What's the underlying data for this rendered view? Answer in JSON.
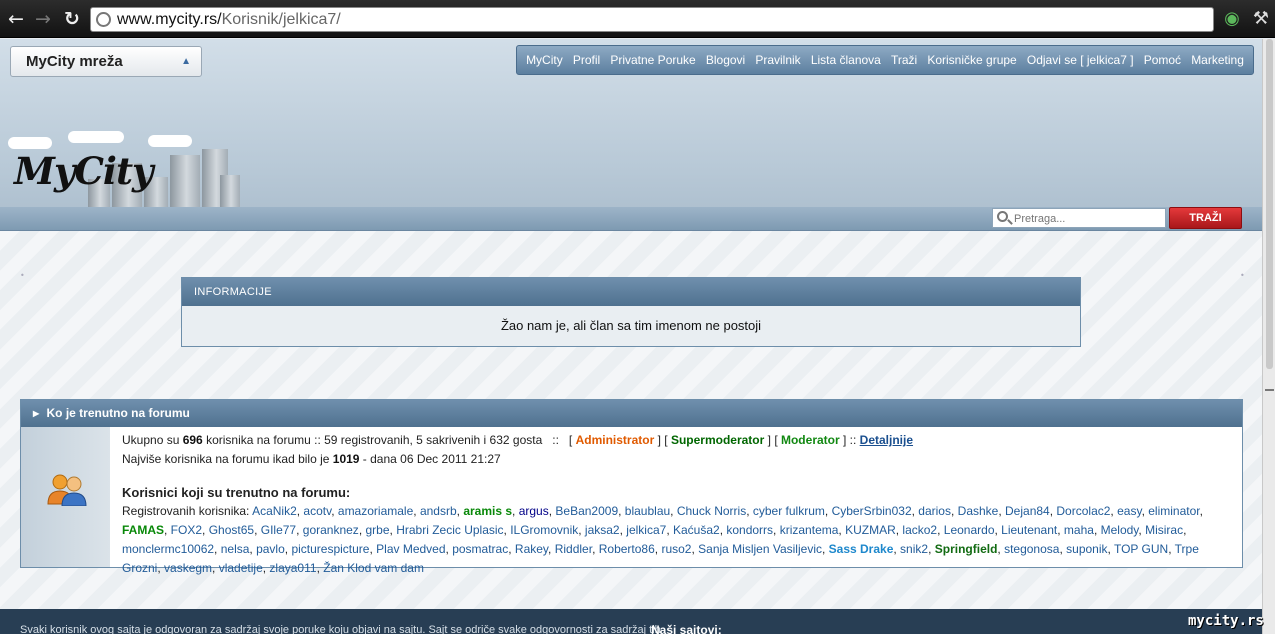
{
  "browser": {
    "url_host": "www.mycity.rs/",
    "url_path": "Korisnik/jelkica7/",
    "back_icon": "back-arrow-icon",
    "forward_icon": "forward-arrow-icon",
    "reload_icon": "reload-icon"
  },
  "header": {
    "network_select": "MyCity mreža",
    "logo_text": "MyCity",
    "nav": [
      "MyCity",
      "Profil",
      "Privatne Poruke",
      "Blogovi",
      "Pravilnik",
      "Lista članova",
      "Traži",
      "Korisničke grupe",
      "Odjavi se [ jelkica7 ]",
      "Pomoć",
      "Marketing"
    ],
    "search_placeholder": "Pretraga...",
    "search_button": "TRAŽI"
  },
  "info": {
    "title": "INFORMACIJE",
    "message": "Žao nam je, ali član sa tim imenom ne postoji"
  },
  "online": {
    "title": "Ko je trenutno na forumu",
    "stats_pre": "Ukupno su ",
    "total": "696",
    "stats_mid": " korisnika na forumu :: 59 registrovanih, 5 sakrivenih i 632 gosta   ::   [ ",
    "admin": "Administrator",
    "sep1": " ] [ ",
    "supermod": "Supermoderator",
    "sep2": " ] [ ",
    "mod": "Moderator",
    "sep3": " ] :: ",
    "details": "Detaljnije",
    "max_pre": "Najviše korisnika na forumu ikad bilo je ",
    "max_count": "1019",
    "max_post": " - dana 06 Dec 2011 21:27",
    "online_heading": "Korisnici koji su trenutno na forumu:",
    "registered_label": "Registrovanih korisnika: ",
    "users": [
      {
        "n": "AcaNik2",
        "s": "user"
      },
      {
        "n": "acotv",
        "s": "user"
      },
      {
        "n": "amazoriamale",
        "s": "user"
      },
      {
        "n": "andsrb",
        "s": "user"
      },
      {
        "n": "aramis s",
        "s": "green"
      },
      {
        "n": "argus",
        "s": "purple"
      },
      {
        "n": "BeBan2009",
        "s": "user"
      },
      {
        "n": "blaublau",
        "s": "user"
      },
      {
        "n": "Chuck Norris",
        "s": "user"
      },
      {
        "n": "cyber fulkrum",
        "s": "user"
      },
      {
        "n": "CyberSrbin032",
        "s": "user"
      },
      {
        "n": "darios",
        "s": "user"
      },
      {
        "n": "Dashke",
        "s": "user"
      },
      {
        "n": "Dejan84",
        "s": "user"
      },
      {
        "n": "Dorcolac2",
        "s": "user"
      },
      {
        "n": "easy",
        "s": "user"
      },
      {
        "n": "eliminator",
        "s": "user"
      },
      {
        "n": "FAMAS",
        "s": "green"
      },
      {
        "n": "FOX2",
        "s": "user"
      },
      {
        "n": "Ghost65",
        "s": "user"
      },
      {
        "n": "GIle77",
        "s": "user"
      },
      {
        "n": "goranknez",
        "s": "user"
      },
      {
        "n": "grbe",
        "s": "user"
      },
      {
        "n": "Hrabri Zecic Uplasic",
        "s": "user"
      },
      {
        "n": "ILGromovnik",
        "s": "user"
      },
      {
        "n": "jaksa2",
        "s": "user"
      },
      {
        "n": "jelkica7",
        "s": "user"
      },
      {
        "n": "Kaćuša2",
        "s": "user"
      },
      {
        "n": "kondorrs",
        "s": "user"
      },
      {
        "n": "krizantema",
        "s": "user"
      },
      {
        "n": "KUZMAR",
        "s": "user"
      },
      {
        "n": "lacko2",
        "s": "user"
      },
      {
        "n": "Leonardo",
        "s": "user"
      },
      {
        "n": "Lieutenant",
        "s": "user"
      },
      {
        "n": "maha",
        "s": "user"
      },
      {
        "n": "Melody",
        "s": "user"
      },
      {
        "n": "Misirac",
        "s": "user"
      },
      {
        "n": "monclermc10062",
        "s": "user"
      },
      {
        "n": "nelsa",
        "s": "user"
      },
      {
        "n": "pavlo",
        "s": "user"
      },
      {
        "n": "picturespicture",
        "s": "user"
      },
      {
        "n": "Plav Medved",
        "s": "user"
      },
      {
        "n": "posmatrac",
        "s": "user"
      },
      {
        "n": "Rakey",
        "s": "user"
      },
      {
        "n": "Riddler",
        "s": "user"
      },
      {
        "n": "Roberto86",
        "s": "user"
      },
      {
        "n": "ruso2",
        "s": "user"
      },
      {
        "n": "Sanja Misljen Vasiljevic",
        "s": "user"
      },
      {
        "n": "Sass Drake",
        "s": "blue"
      },
      {
        "n": "snik2",
        "s": "user"
      },
      {
        "n": "Springfield",
        "s": "dgreen"
      },
      {
        "n": "stegonosa",
        "s": "user"
      },
      {
        "n": "suponik",
        "s": "user"
      },
      {
        "n": "TOP GUN",
        "s": "user"
      },
      {
        "n": "Trpe Grozni",
        "s": "user"
      },
      {
        "n": "vaskegm",
        "s": "user"
      },
      {
        "n": "vladetije",
        "s": "user"
      },
      {
        "n": "zlaya011",
        "s": "user"
      },
      {
        "n": "Žan Klod vam dam",
        "s": "user"
      }
    ]
  },
  "footer": {
    "left": "Svaki korisnik ovog sajta je odgovoran za sadržaj svoje poruke koju objavi na sajtu. Sajt se odriče svake odgovornosti za sadržaj tih",
    "right": "Naši sajtovi:"
  },
  "watermark": "mycity.rs",
  "colors": {
    "nav_bg": "#5c7f9f",
    "panel_header": "#4f718f",
    "search_button": "#c41f22",
    "footer_bg": "#283e54",
    "admin": "#e05a00",
    "supermod": "#006600",
    "moderator": "#118811"
  }
}
